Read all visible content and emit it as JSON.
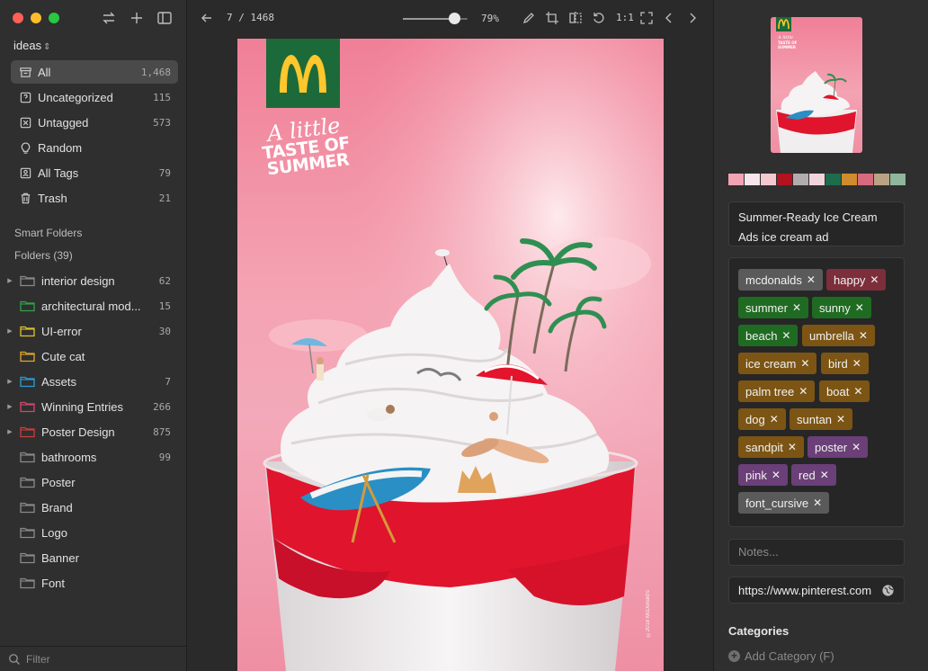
{
  "sidebar": {
    "library_name": "ideas",
    "nav": [
      {
        "label": "All",
        "count": "1,468",
        "icon": "archive-icon"
      },
      {
        "label": "Uncategorized",
        "count": "115",
        "icon": "uncategorized-icon"
      },
      {
        "label": "Untagged",
        "count": "573",
        "icon": "untagged-icon"
      },
      {
        "label": "Random",
        "count": "",
        "icon": "lightbulb-icon"
      },
      {
        "label": "All Tags",
        "count": "79",
        "icon": "tags-icon"
      },
      {
        "label": "Trash",
        "count": "21",
        "icon": "trash-icon"
      }
    ],
    "smart_folders_label": "Smart Folders",
    "folders_label": "Folders (39)",
    "folders": [
      {
        "label": "interior design",
        "count": "62",
        "color": "#8a8a8a",
        "expandable": true
      },
      {
        "label": "architectural mod...",
        "count": "15",
        "color": "#2fa34a",
        "expandable": false
      },
      {
        "label": "UI-error",
        "count": "30",
        "color": "#e0c22a",
        "expandable": true
      },
      {
        "label": "Cute cat",
        "count": "",
        "color": "#e0a72a",
        "expandable": false
      },
      {
        "label": "Assets",
        "count": "7",
        "color": "#2a9ed6",
        "expandable": true
      },
      {
        "label": "Winning Entries",
        "count": "266",
        "color": "#d2476e",
        "expandable": true
      },
      {
        "label": "Poster Design",
        "count": "875",
        "color": "#d23b3b",
        "expandable": true
      },
      {
        "label": "bathrooms",
        "count": "99",
        "color": "#8a8a8a",
        "expandable": false
      },
      {
        "label": "Poster",
        "count": "",
        "color": "#8a8a8a",
        "expandable": false
      },
      {
        "label": "Brand",
        "count": "",
        "color": "#8a8a8a",
        "expandable": false
      },
      {
        "label": "Logo",
        "count": "",
        "color": "#8a8a8a",
        "expandable": false
      },
      {
        "label": "Banner",
        "count": "",
        "color": "#8a8a8a",
        "expandable": false
      },
      {
        "label": "Font",
        "count": "",
        "color": "#8a8a8a",
        "expandable": false
      }
    ],
    "filter_placeholder": "Filter"
  },
  "viewer": {
    "pager": "7 / 1468",
    "zoom": 0.79,
    "zoom_label": "79%",
    "one_to_one": "1:1",
    "poster": {
      "slogan_line1": "A little",
      "slogan_line2": "TASTE OF",
      "slogan_line3": "SUMMER",
      "brand_color": "#1c6a39",
      "credit": "©2018 McDonald's"
    }
  },
  "inspector": {
    "swatches": [
      "#f2a4b4",
      "#f4e6ea",
      "#f3c8d1",
      "#b3121e",
      "#b3acae",
      "#f1d4db",
      "#1e6b4d",
      "#cf8c2c",
      "#d66a7e",
      "#b9a384",
      "#8fb79a"
    ],
    "title": "Summer-Ready Ice Cream Ads  ice cream ad",
    "tags": [
      {
        "label": "mcdonalds",
        "color": "gray"
      },
      {
        "label": "happy",
        "color": "red"
      },
      {
        "label": "summer",
        "color": "green"
      },
      {
        "label": "sunny",
        "color": "green"
      },
      {
        "label": "beach",
        "color": "green"
      },
      {
        "label": "umbrella",
        "color": "brown"
      },
      {
        "label": "ice cream",
        "color": "brown"
      },
      {
        "label": "bird",
        "color": "brown"
      },
      {
        "label": "palm tree",
        "color": "brown"
      },
      {
        "label": "boat",
        "color": "brown"
      },
      {
        "label": "dog",
        "color": "brown"
      },
      {
        "label": "suntan",
        "color": "brown"
      },
      {
        "label": "sandpit",
        "color": "brown"
      },
      {
        "label": "poster",
        "color": "purple"
      },
      {
        "label": "pink",
        "color": "purple"
      },
      {
        "label": "red",
        "color": "purple"
      },
      {
        "label": "font_cursive",
        "color": "gray"
      }
    ],
    "notes_placeholder": "Notes...",
    "url": "https://www.pinterest.com",
    "categories_title": "Categories",
    "add_category": "Add Category (F)"
  }
}
